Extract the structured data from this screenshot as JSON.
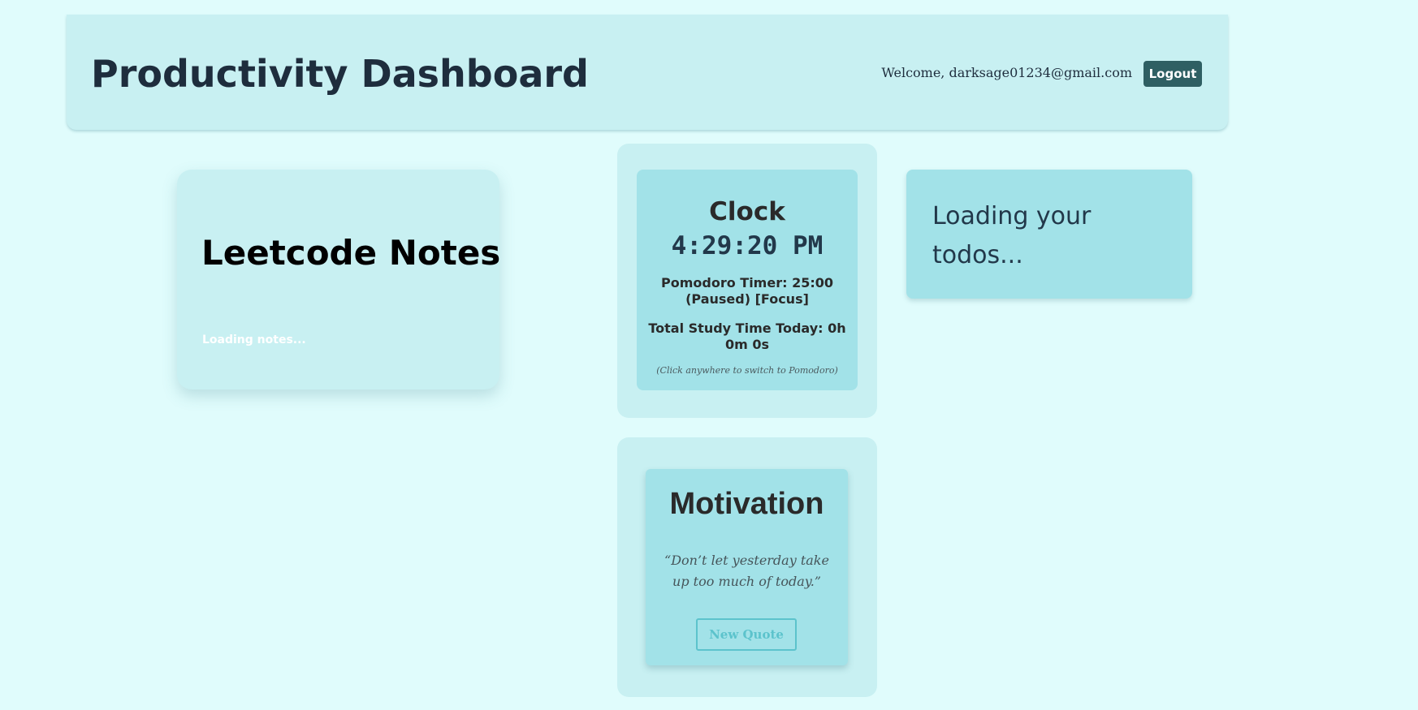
{
  "header": {
    "title": "Productivity Dashboard",
    "welcome": "Welcome, darksage01234@gmail.com",
    "logout_label": "Logout"
  },
  "notes": {
    "title": "Leetcode Notes",
    "loading": "Loading notes..."
  },
  "clock": {
    "heading": "Clock",
    "time": "4:29:20 PM",
    "pomodoro": "Pomodoro Timer: 25:00 (Paused) [Focus]",
    "study_time": "Total Study Time Today: 0h 0m 0s",
    "hint": "(Click anywhere to switch to Pomodoro)"
  },
  "motivation": {
    "heading": "Motivation",
    "quote": "“Don’t let yesterday take up too much of today.”",
    "new_quote_label": "New Quote"
  },
  "todos": {
    "loading": "Loading your todos..."
  },
  "colors": {
    "page_background": "#e0fcfc",
    "card_background": "#c8f0f2",
    "inner_card": "#a2e2e8",
    "logout_button": "#2f5f63",
    "accent": "#5cc3cc"
  }
}
